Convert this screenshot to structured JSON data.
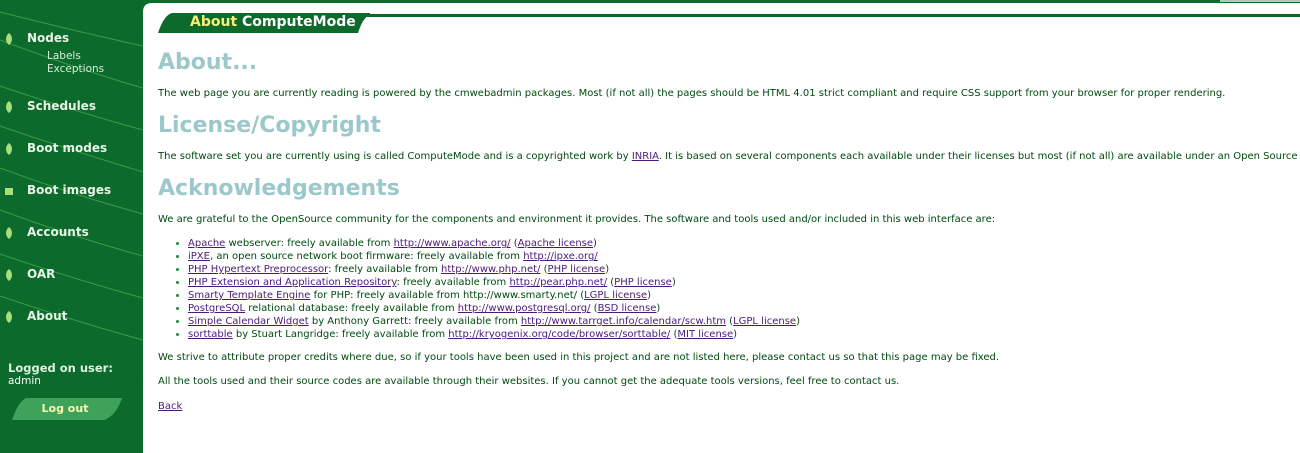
{
  "sidebar": {
    "nav": [
      {
        "label": "Nodes",
        "sub": [
          "Labels",
          "Exceptions"
        ]
      },
      {
        "label": "Schedules"
      },
      {
        "label": "Boot modes"
      },
      {
        "label": "Boot images"
      },
      {
        "label": "Accounts"
      },
      {
        "label": "OAR"
      },
      {
        "label": "About"
      }
    ],
    "logged_label": "Logged on user:",
    "user": "admin",
    "logout_label": "Log out"
  },
  "header": {
    "tab_prefix": "About",
    "tab_title": "ComputeMode"
  },
  "content": {
    "about": {
      "heading": "About...",
      "text": "The web page you are currently reading is powered by the cmwebadmin packages. Most (if not all) the pages should be HTML 4.01 strict compliant and require CSS support from your browser for proper rendering."
    },
    "license": {
      "heading": "License/Copyright",
      "text_before": "The software set you are currently using is called ComputeMode and is a copyrighted work by ",
      "link": "INRIA",
      "text_after": ". It is based on several components each available under their licenses but most (if not all) are available under an Open Source License."
    },
    "ack": {
      "heading": "Acknowledgements",
      "intro": "We are grateful to the OpenSource community for the components and environment it provides. The software and tools used and/or included in this web interface are:",
      "items": [
        {
          "parts": [
            {
              "t": "Apache",
              "link": true
            },
            {
              "t": " webserver: freely available from "
            },
            {
              "t": "http://www.apache.org/",
              "link": true
            },
            {
              "t": " ("
            },
            {
              "t": "Apache license",
              "link": true
            },
            {
              "t": ")"
            }
          ]
        },
        {
          "parts": [
            {
              "t": "iPXE",
              "link": true
            },
            {
              "t": ", an open source network boot firmware: freely available from "
            },
            {
              "t": "http://ipxe.org/",
              "link": true
            }
          ]
        },
        {
          "parts": [
            {
              "t": "PHP Hypertext Preprocessor",
              "link": true
            },
            {
              "t": ": freely available from "
            },
            {
              "t": "http://www.php.net/",
              "link": true
            },
            {
              "t": " ("
            },
            {
              "t": "PHP license",
              "link": true
            },
            {
              "t": ")"
            }
          ]
        },
        {
          "parts": [
            {
              "t": "PHP Extension and Application Repository",
              "link": true
            },
            {
              "t": ": freely available from "
            },
            {
              "t": "http://pear.php.net/",
              "link": true
            },
            {
              "t": " ("
            },
            {
              "t": "PHP license",
              "link": true
            },
            {
              "t": ")"
            }
          ]
        },
        {
          "parts": [
            {
              "t": "Smarty Template Engine",
              "link": true
            },
            {
              "t": " for PHP: freely available from http://www.smarty.net/ ("
            },
            {
              "t": "LGPL license",
              "link": true
            },
            {
              "t": ")"
            }
          ]
        },
        {
          "parts": [
            {
              "t": "PostgreSQL",
              "link": true
            },
            {
              "t": " relational database: freely available from "
            },
            {
              "t": "http://www.postgresql.org/",
              "link": true
            },
            {
              "t": " ("
            },
            {
              "t": "BSD license",
              "link": true
            },
            {
              "t": ")"
            }
          ]
        },
        {
          "parts": [
            {
              "t": "Simple Calendar Widget",
              "link": true
            },
            {
              "t": " by Anthony Garrett: freely available from "
            },
            {
              "t": "http://www.tarrget.info/calendar/scw.htm",
              "link": true
            },
            {
              "t": " ("
            },
            {
              "t": "LGPL license",
              "link": true
            },
            {
              "t": ")"
            }
          ]
        },
        {
          "parts": [
            {
              "t": "sorttable",
              "link": true
            },
            {
              "t": " by Stuart Langridge: freely available from "
            },
            {
              "t": "http://kryogenix.org/code/browser/sorttable/",
              "link": true
            },
            {
              "t": " ("
            },
            {
              "t": "MIT license",
              "link": true
            },
            {
              "t": ")"
            }
          ]
        }
      ],
      "strive": "We strive to attribute proper credits where due, so if your tools have been used in this project and are not listed here, please contact us so that this page may be fixed.",
      "sources": "All the tools used and their source codes are available through their websites. If you cannot get the adequate tools versions, feel free to contact us."
    },
    "back": "Back"
  },
  "colors": {
    "sidebar": "#0c6a2c",
    "heading": "#9cc8cc",
    "text": "#004a10",
    "link": "#4a1a7a",
    "tab_prefix": "#f6f07a"
  }
}
